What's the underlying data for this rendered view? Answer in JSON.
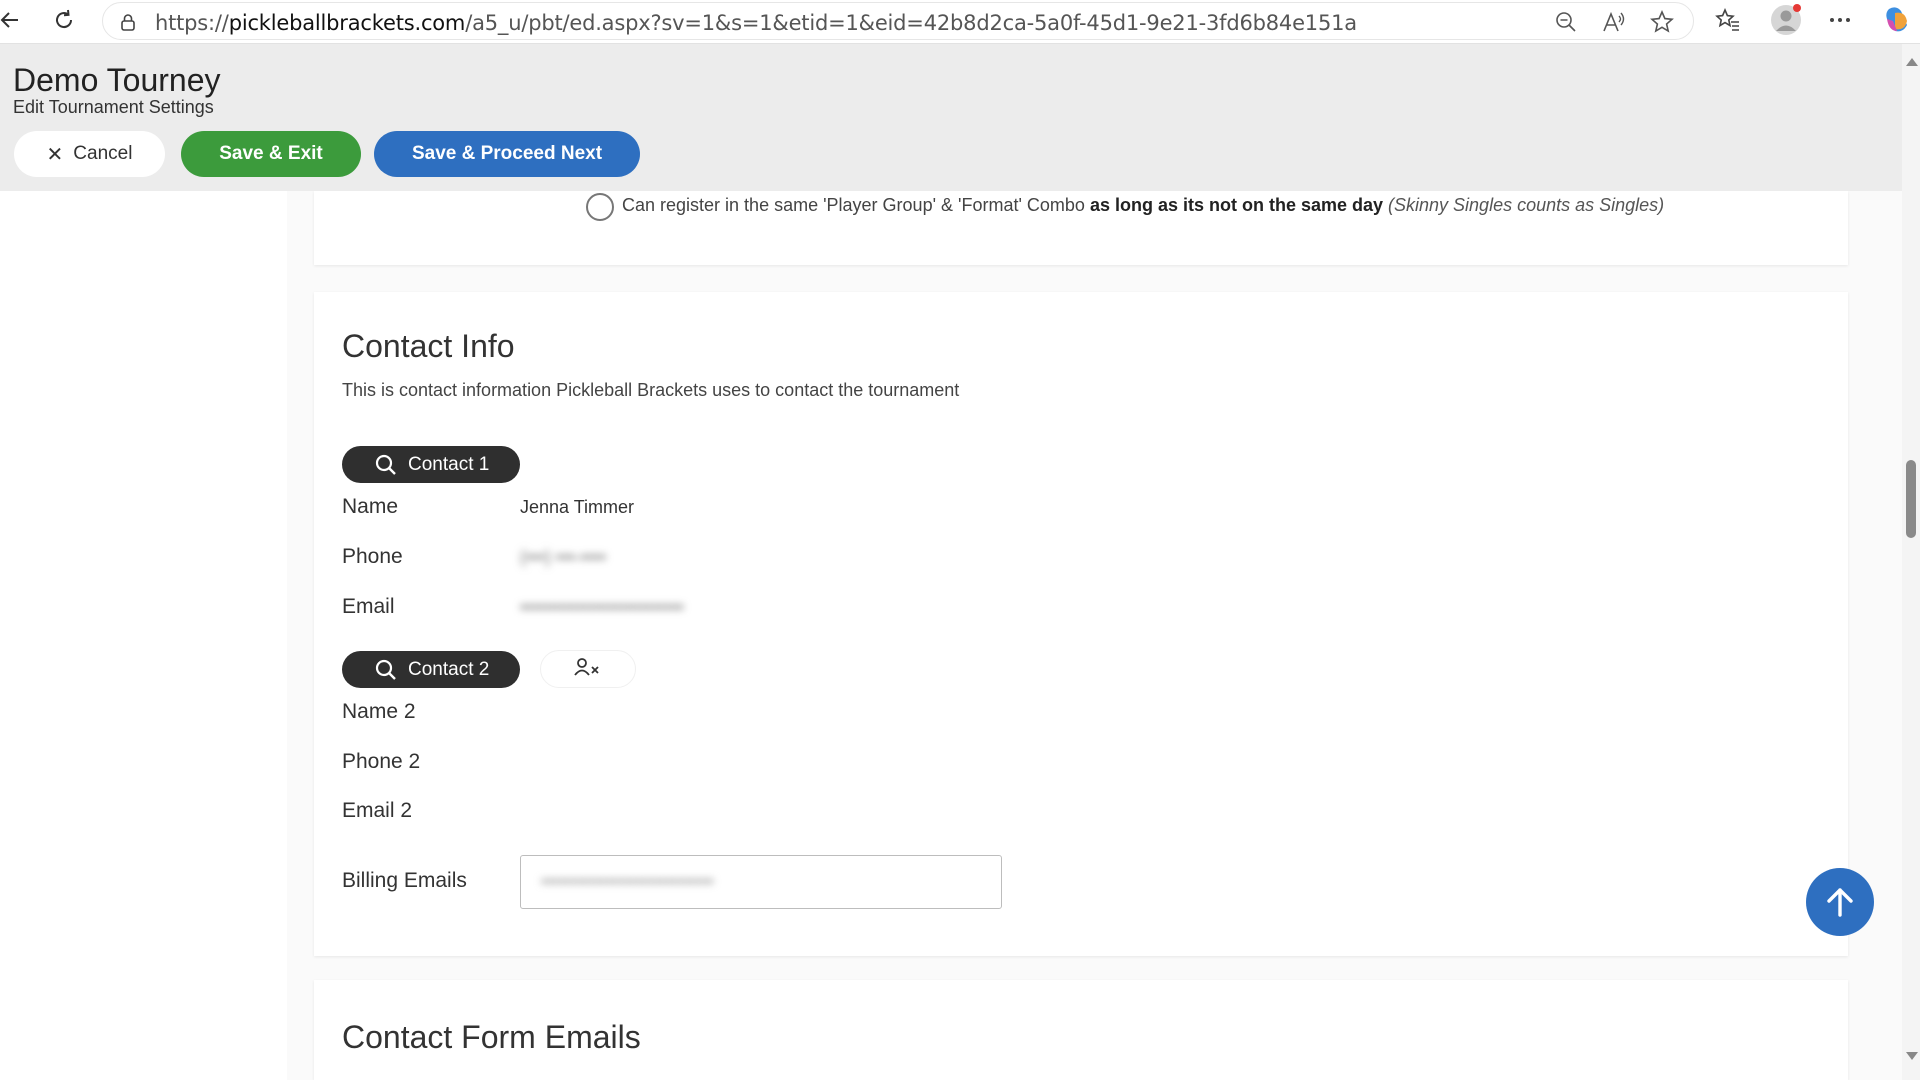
{
  "browser": {
    "url_prefix": "https://",
    "url_domain": "pickleballbrackets.com",
    "url_path": "/a5_u/pbt/ed.aspx?sv=1&s=1&etid=1&eid=42b8d2ca-5a0f-45d1-9e21-3fd6b84e151a"
  },
  "header": {
    "tourney_name": "Demo Tourney",
    "subtitle": "Edit Tournament Settings",
    "cancel_label": "Cancel",
    "save_exit_label": "Save & Exit",
    "save_next_label": "Save & Proceed Next"
  },
  "registration_option": {
    "text_before": "Can register in the same 'Player Group' & 'Format' Combo ",
    "text_bold": "as long as its not on the same day",
    "text_italic": " (Skinny Singles counts as Singles)"
  },
  "contact_info": {
    "title": "Contact Info",
    "description": "This is contact information Pickleball Brackets uses to contact the tournament",
    "contact1": {
      "button_label": "Contact 1",
      "name_label": "Name",
      "name_value": "Jenna Timmer",
      "phone_label": "Phone",
      "phone_value": "(•••) •••-••••",
      "email_label": "Email",
      "email_value": "••••••••••••••••••••••••••"
    },
    "contact2": {
      "button_label": "Contact 2",
      "name_label": "Name 2",
      "phone_label": "Phone 2",
      "email_label": "Email 2"
    },
    "billing_label": "Billing Emails",
    "billing_value": "•••••••••••••••••••••••••••••"
  },
  "contact_form": {
    "title": "Contact Form Emails"
  },
  "colors": {
    "save_exit": "#3c9b3c",
    "save_next": "#2e6fc0",
    "contact_pill": "#2f2f2f",
    "header_bg": "#ececec"
  }
}
